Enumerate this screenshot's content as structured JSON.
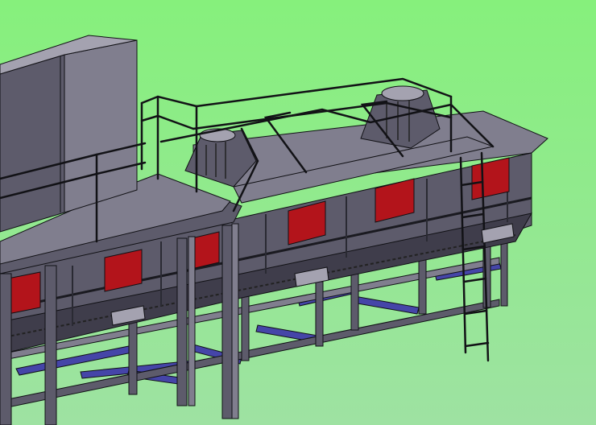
{
  "scene": {
    "subject": "3d-cad-model-industrial-conveyor-structure",
    "colors": {
      "background_top": "#86f07c",
      "background_bottom": "#9ee2a2",
      "steel_dark": "#3f3d4b",
      "steel_mid": "#5d5b6b",
      "steel_light": "#807e8e",
      "steel_highlight": "#a4a2b0",
      "edge": "#101014",
      "red_panel": "#b3141b",
      "blue_beam": "#4545a8"
    }
  }
}
